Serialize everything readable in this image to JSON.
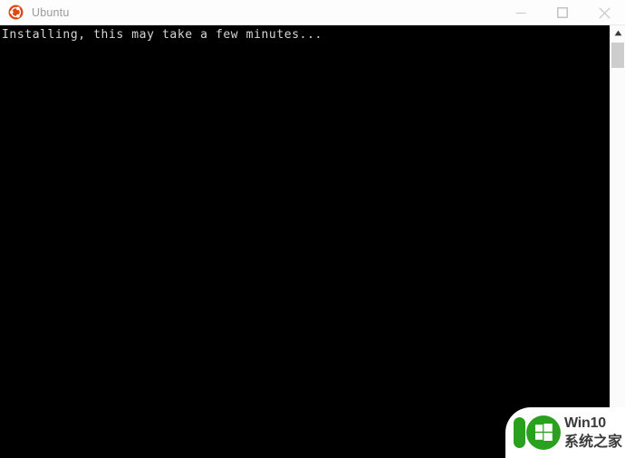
{
  "window": {
    "title": "Ubuntu",
    "app_icon": "ubuntu-logo-icon",
    "accent_color": "#dd4814",
    "titlebar_background": "#fdfdfd",
    "title_color": "#9a9a9a",
    "controls": [
      {
        "name": "minimize",
        "label": "Minimize",
        "glyph": "minimize-icon"
      },
      {
        "name": "maximize",
        "label": "Maximize",
        "glyph": "maximize-icon"
      },
      {
        "name": "close",
        "label": "Close",
        "glyph": "close-icon"
      }
    ]
  },
  "terminal": {
    "background": "#000000",
    "foreground": "#d6d6d6",
    "lines": [
      "Installing, this may take a few minutes..."
    ]
  },
  "scrollbar": {
    "up_arrow": "chevron-up-icon",
    "track_color": "#fbfbfb",
    "thumb_color": "#cdcdcd"
  },
  "watermark": {
    "logo": "win10-ten-logo-icon",
    "brand_color": "#2aa11e",
    "line1": "Win10",
    "line2": "系统之家"
  }
}
